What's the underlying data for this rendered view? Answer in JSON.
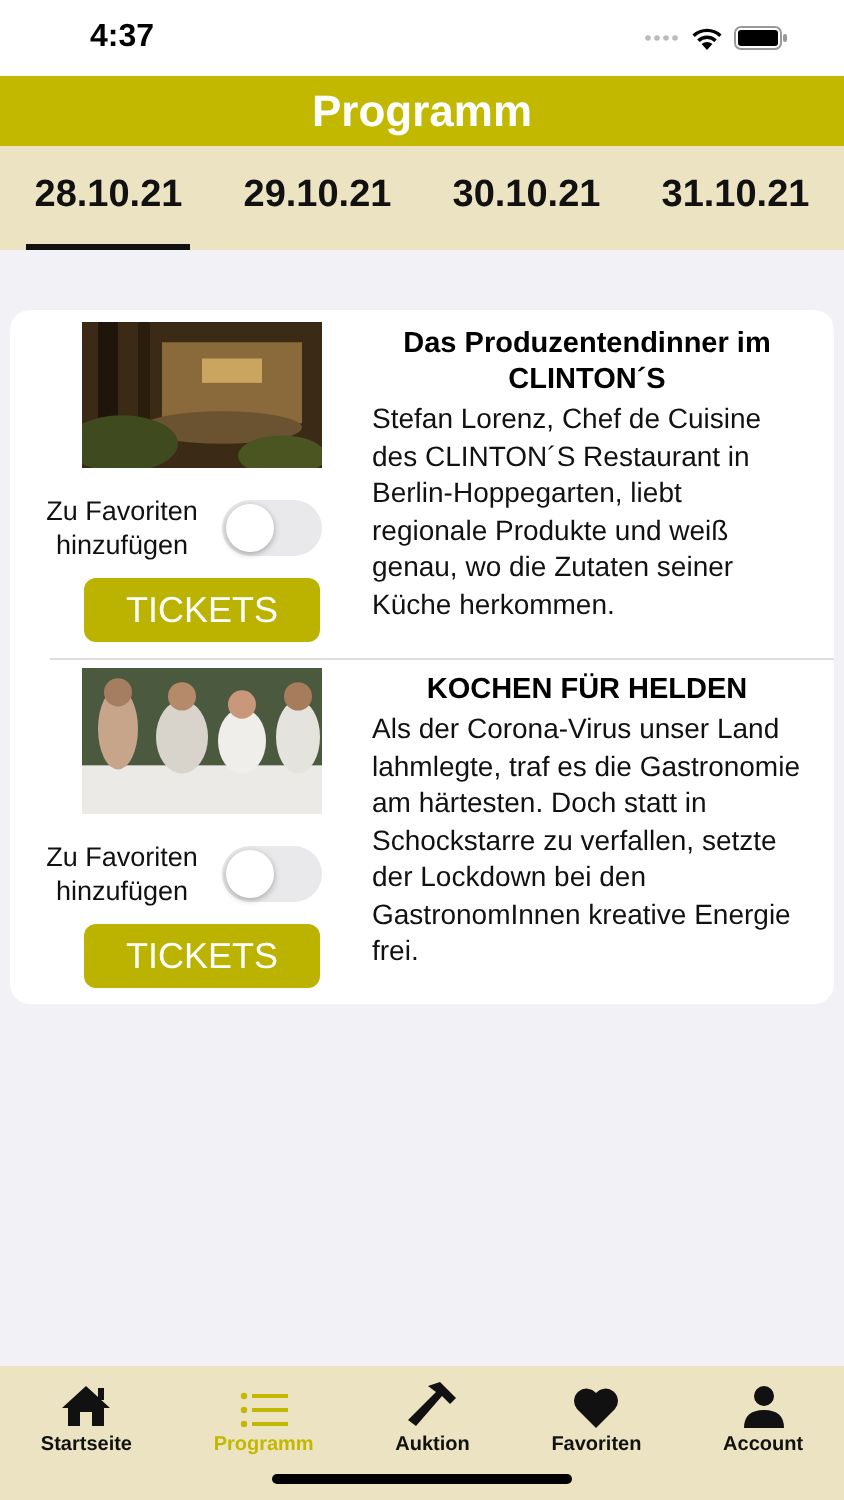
{
  "status_bar": {
    "time": "4:37"
  },
  "header": {
    "title": "Programm"
  },
  "tabs": [
    {
      "label": "28.10.21",
      "selected": true
    },
    {
      "label": "29.10.21",
      "selected": false
    },
    {
      "label": "30.10.21",
      "selected": false
    },
    {
      "label": "31.10.21",
      "selected": false
    }
  ],
  "events": [
    {
      "kind": "picture",
      "title": "Das Produzentendinner im CLINTON´S",
      "description": "Stefan Lorenz, Chef de Cuisine des CLINTON´S Restaurant in Berlin-Hoppegarten, liebt regionale Produkte und weiß genau, wo die Zutaten seiner Küche herkommen.",
      "favorite_label": "Zu Favoriten hinzufügen",
      "favorite": false,
      "button": "TICKETS"
    },
    {
      "kind": "picture",
      "title": "KOCHEN FÜR HELDEN",
      "description": "Als der Corona-Virus unser Land lahmlegte, traf es die Gastronomie am härtesten. Doch statt in Schockstarre zu verfallen, setzte der Lockdown bei den GastronomInnen kreative Energie frei.",
      "favorite_label": "Zu Favoriten hinzufügen",
      "favorite": false,
      "button": "TICKETS"
    }
  ],
  "nav": [
    {
      "label": "Startseite",
      "selected": false
    },
    {
      "label": "Programm",
      "selected": true
    },
    {
      "label": "Auktion",
      "selected": false
    },
    {
      "label": "Favoriten",
      "selected": false
    },
    {
      "label": "Account",
      "selected": false
    }
  ]
}
